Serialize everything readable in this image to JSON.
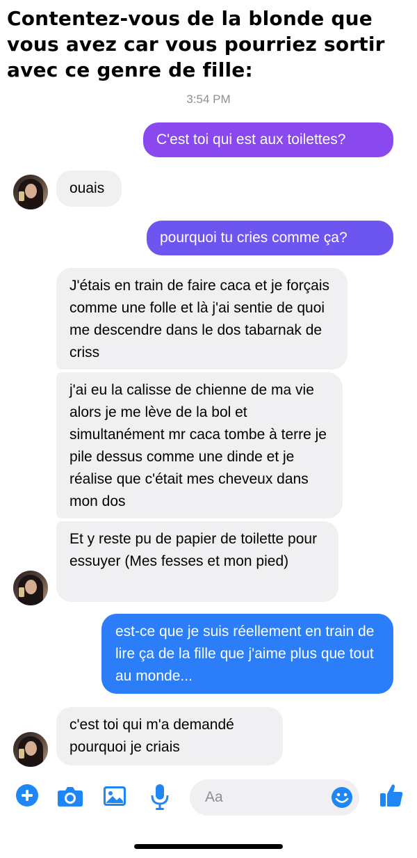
{
  "caption": "Contentez-vous de la blonde que vous avez car vous pourriez sortir avec ce genre de fille:",
  "timestamp": "3:54 PM",
  "messages": [
    {
      "direction": "sent",
      "text": "C'est toi qui est aux toilettes?"
    },
    {
      "direction": "received",
      "text": "ouais"
    },
    {
      "direction": "sent",
      "text": "pourquoi tu cries comme ça?"
    },
    {
      "direction": "received",
      "text": "J'étais en train de faire caca et je forçais comme une folle et là j'ai sentie de quoi me descendre dans le dos tabarnak de criss"
    },
    {
      "direction": "received",
      "text": "j'ai eu la calisse de chienne de ma vie alors je me lève de la bol et simultanément mr caca tombe à terre je pile dessus comme une dinde et je réalise que c'était mes cheveux dans mon dos"
    },
    {
      "direction": "received",
      "text": "Et y reste pu de papier de toilette pour essuyer (Mes fesses et mon pied)"
    },
    {
      "direction": "sent",
      "text": "est-ce que je suis réellement en train de lire ça de la fille que j'aime plus que tout au monde..."
    },
    {
      "direction": "received",
      "text": "c'est toi qui m'a demandé pourquoi je criais"
    }
  ],
  "composer": {
    "placeholder": "Aa"
  },
  "colors": {
    "sent_purple": "#8a48ef",
    "sent_blue": "#2b7ef8",
    "received_bg": "#f0f0f2",
    "toolbar_accent": "#1f86f5"
  },
  "toolbar_icons": [
    "plus-icon",
    "camera-icon",
    "image-icon",
    "microphone-icon",
    "emoji-icon",
    "thumbs-up-icon"
  ]
}
